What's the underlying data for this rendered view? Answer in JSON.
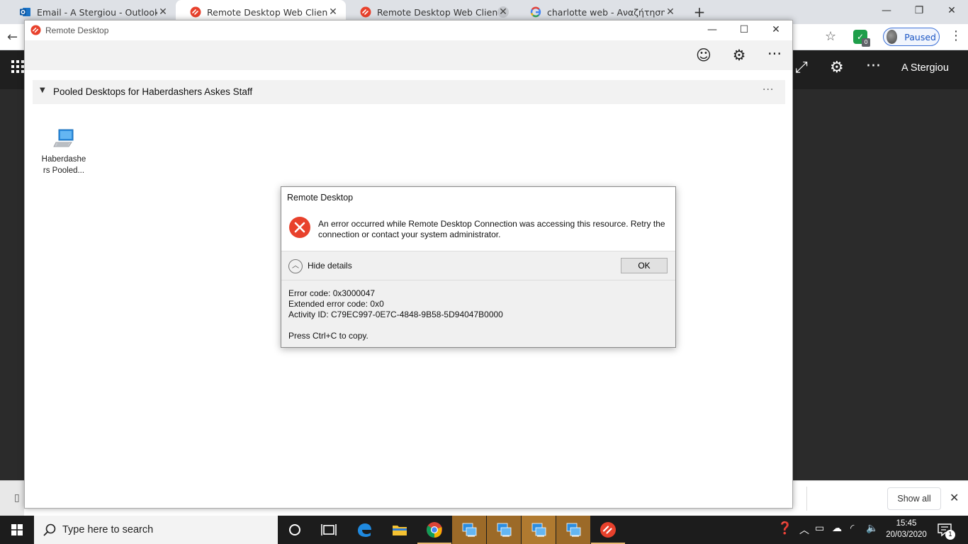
{
  "browser": {
    "tabs": [
      {
        "title": "Email - A Stergiou - Outlook",
        "favicon": "outlook-icon",
        "active": false
      },
      {
        "title": "Remote Desktop Web Client",
        "favicon": "remote-desktop-icon",
        "active": true
      },
      {
        "title": "Remote Desktop Web Client",
        "favicon": "remote-desktop-icon",
        "active": false
      },
      {
        "title": "charlotte web - Αναζήτηση Goog",
        "favicon": "google-icon",
        "active": false
      }
    ],
    "new_tab": "+",
    "profile_label": "Paused",
    "extension_badge": "0"
  },
  "web_client": {
    "user_name": "A Stergiou"
  },
  "downloads": {
    "show_all": "Show all"
  },
  "app": {
    "title": "Remote Desktop",
    "group_title": "Pooled Desktops for Haberdashers Askes Staff",
    "group_more": "···",
    "resource_label_line1": "Haberdashe",
    "resource_label_line2": "rs Pooled..."
  },
  "dialog": {
    "title": "Remote Desktop",
    "message": "An error occurred while Remote Desktop Connection was accessing this resource. Retry the connection or contact your system administrator.",
    "details_toggle": "Hide details",
    "ok": "OK",
    "error_code": "Error code: 0x3000047",
    "extended_error_code": "Extended error code: 0x0",
    "activity_id": "Activity ID: C79EC997-0E7C-4848-9B58-5D94047B0000",
    "copy_hint": "Press Ctrl+C to copy."
  },
  "taskbar": {
    "search_placeholder": "Type here to search",
    "time": "15:45",
    "date": "20/03/2020",
    "notification_count": "1"
  },
  "colors": {
    "accent_red": "#e8412c",
    "taskbar_running": "#9c6a28",
    "chrome_tabstrip": "#dee1e6",
    "web_header": "#1f1f1f"
  }
}
